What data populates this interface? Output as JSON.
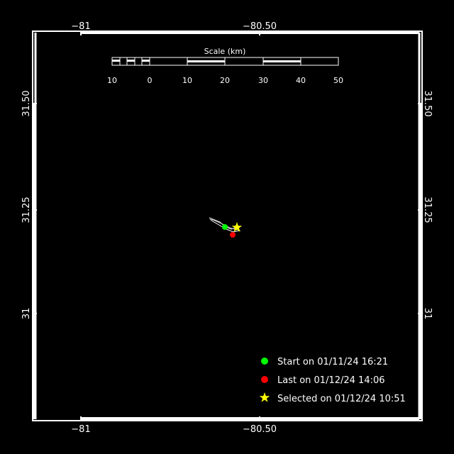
{
  "map": {
    "top_lon_labels": [
      "−81",
      "−80.50"
    ],
    "bottom_lon_labels": [
      "−81",
      "−80.50"
    ],
    "left_lat_labels": [
      "31.50",
      "31.25",
      "31"
    ],
    "right_lat_labels": [
      "31.50",
      "31.25",
      "31"
    ],
    "scale": {
      "title": "Scale (km)",
      "ticks": [
        "10",
        "0",
        "10",
        "20",
        "30",
        "40",
        "50"
      ]
    },
    "legend": {
      "start": "Start on 01/11/24 16:21",
      "last": "Last on 01/12/24 14:06",
      "selected": "Selected on 01/12/24 10:51"
    },
    "colors": {
      "background": "#000000",
      "frame": "#ffffff",
      "start": "#00ff00",
      "last": "#ff0000",
      "selected": "#ffff00",
      "track": "#ffffff"
    }
  }
}
